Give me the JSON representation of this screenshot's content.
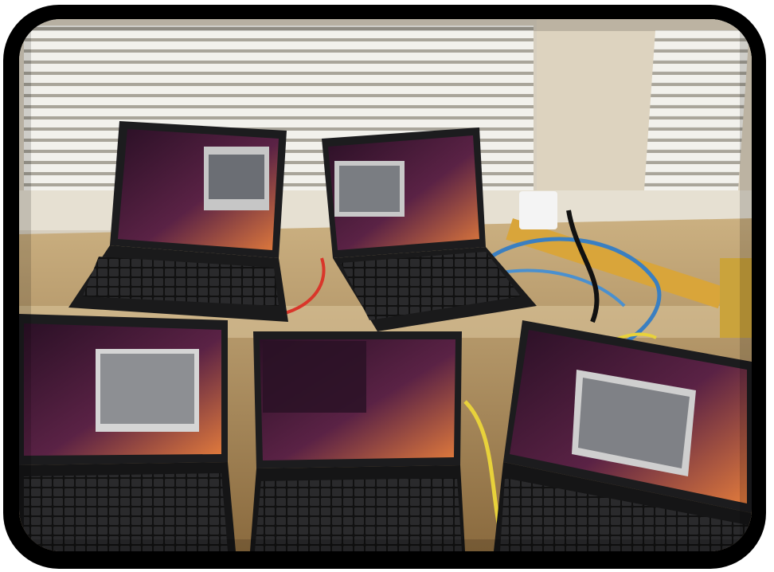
{
  "scene": {
    "description_free": true,
    "laptops": [
      {
        "id": "top-left",
        "screen": "terminal-with-video"
      },
      {
        "id": "top-right",
        "screen": "video-with-terminal"
      },
      {
        "id": "bottom-left",
        "screen": "terminal-with-video"
      },
      {
        "id": "bottom-center",
        "screen": "terminal-only"
      },
      {
        "id": "bottom-right",
        "screen": "terminal-with-video"
      }
    ],
    "colors": {
      "frame": "#000000",
      "wall": "#d9d2c2",
      "blind": "#eceae3",
      "desk": "#c9a56b",
      "laptop_body": "#1c1c1e",
      "screen_bg": "#4a1f3a",
      "screen_accent": "#e07a3c",
      "cable_blue": "#3a7fc1",
      "cable_yellow": "#e8d23b",
      "power_strip": "#d9a53a"
    }
  }
}
